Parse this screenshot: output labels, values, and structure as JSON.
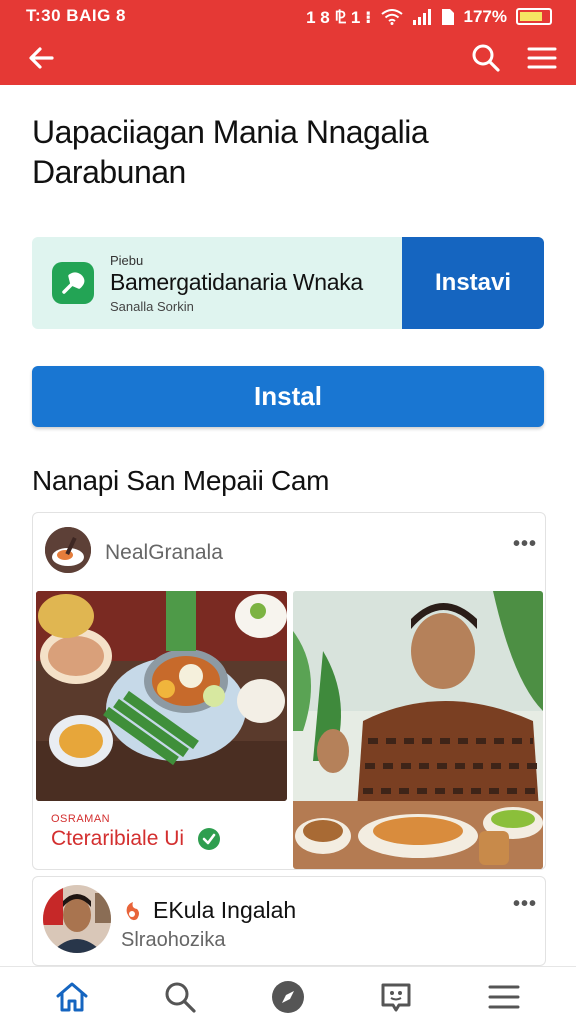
{
  "status_bar": {
    "time": "T:30 BAIG 8",
    "indicators": "1 8 ⅊ 1 ⁝",
    "battery": "177%"
  },
  "app_bar": {
    "icons": [
      "back-arrow-icon",
      "search-icon",
      "menu-icon"
    ],
    "color": "#e53935"
  },
  "page": {
    "title": "Uapaciiagan Mania Nnagalia Darabunan"
  },
  "ad": {
    "sponsor": "Piebu",
    "app_name": "Bamergatidanaria Wnaka",
    "subtitle": "Sanalla Sorkin",
    "cta": "Instavi",
    "accent": "#1565c0"
  },
  "install_button": {
    "label": "Instal",
    "color": "#1976d2"
  },
  "section": {
    "heading": "Nanapi San Mepaii Cam"
  },
  "post": {
    "author": "NealGranala",
    "more": "•••",
    "tag": "OSRAMAN",
    "caption": "Cteraribiale Ui"
  },
  "post2": {
    "name": "EKula Ingalah",
    "handle": "Slraohozika",
    "more": "•••"
  },
  "bottom_nav": {
    "items": [
      "home-icon",
      "search-icon",
      "compass-icon",
      "chat-icon",
      "menu-icon"
    ],
    "active": "home-icon",
    "active_color": "#1565c0"
  }
}
